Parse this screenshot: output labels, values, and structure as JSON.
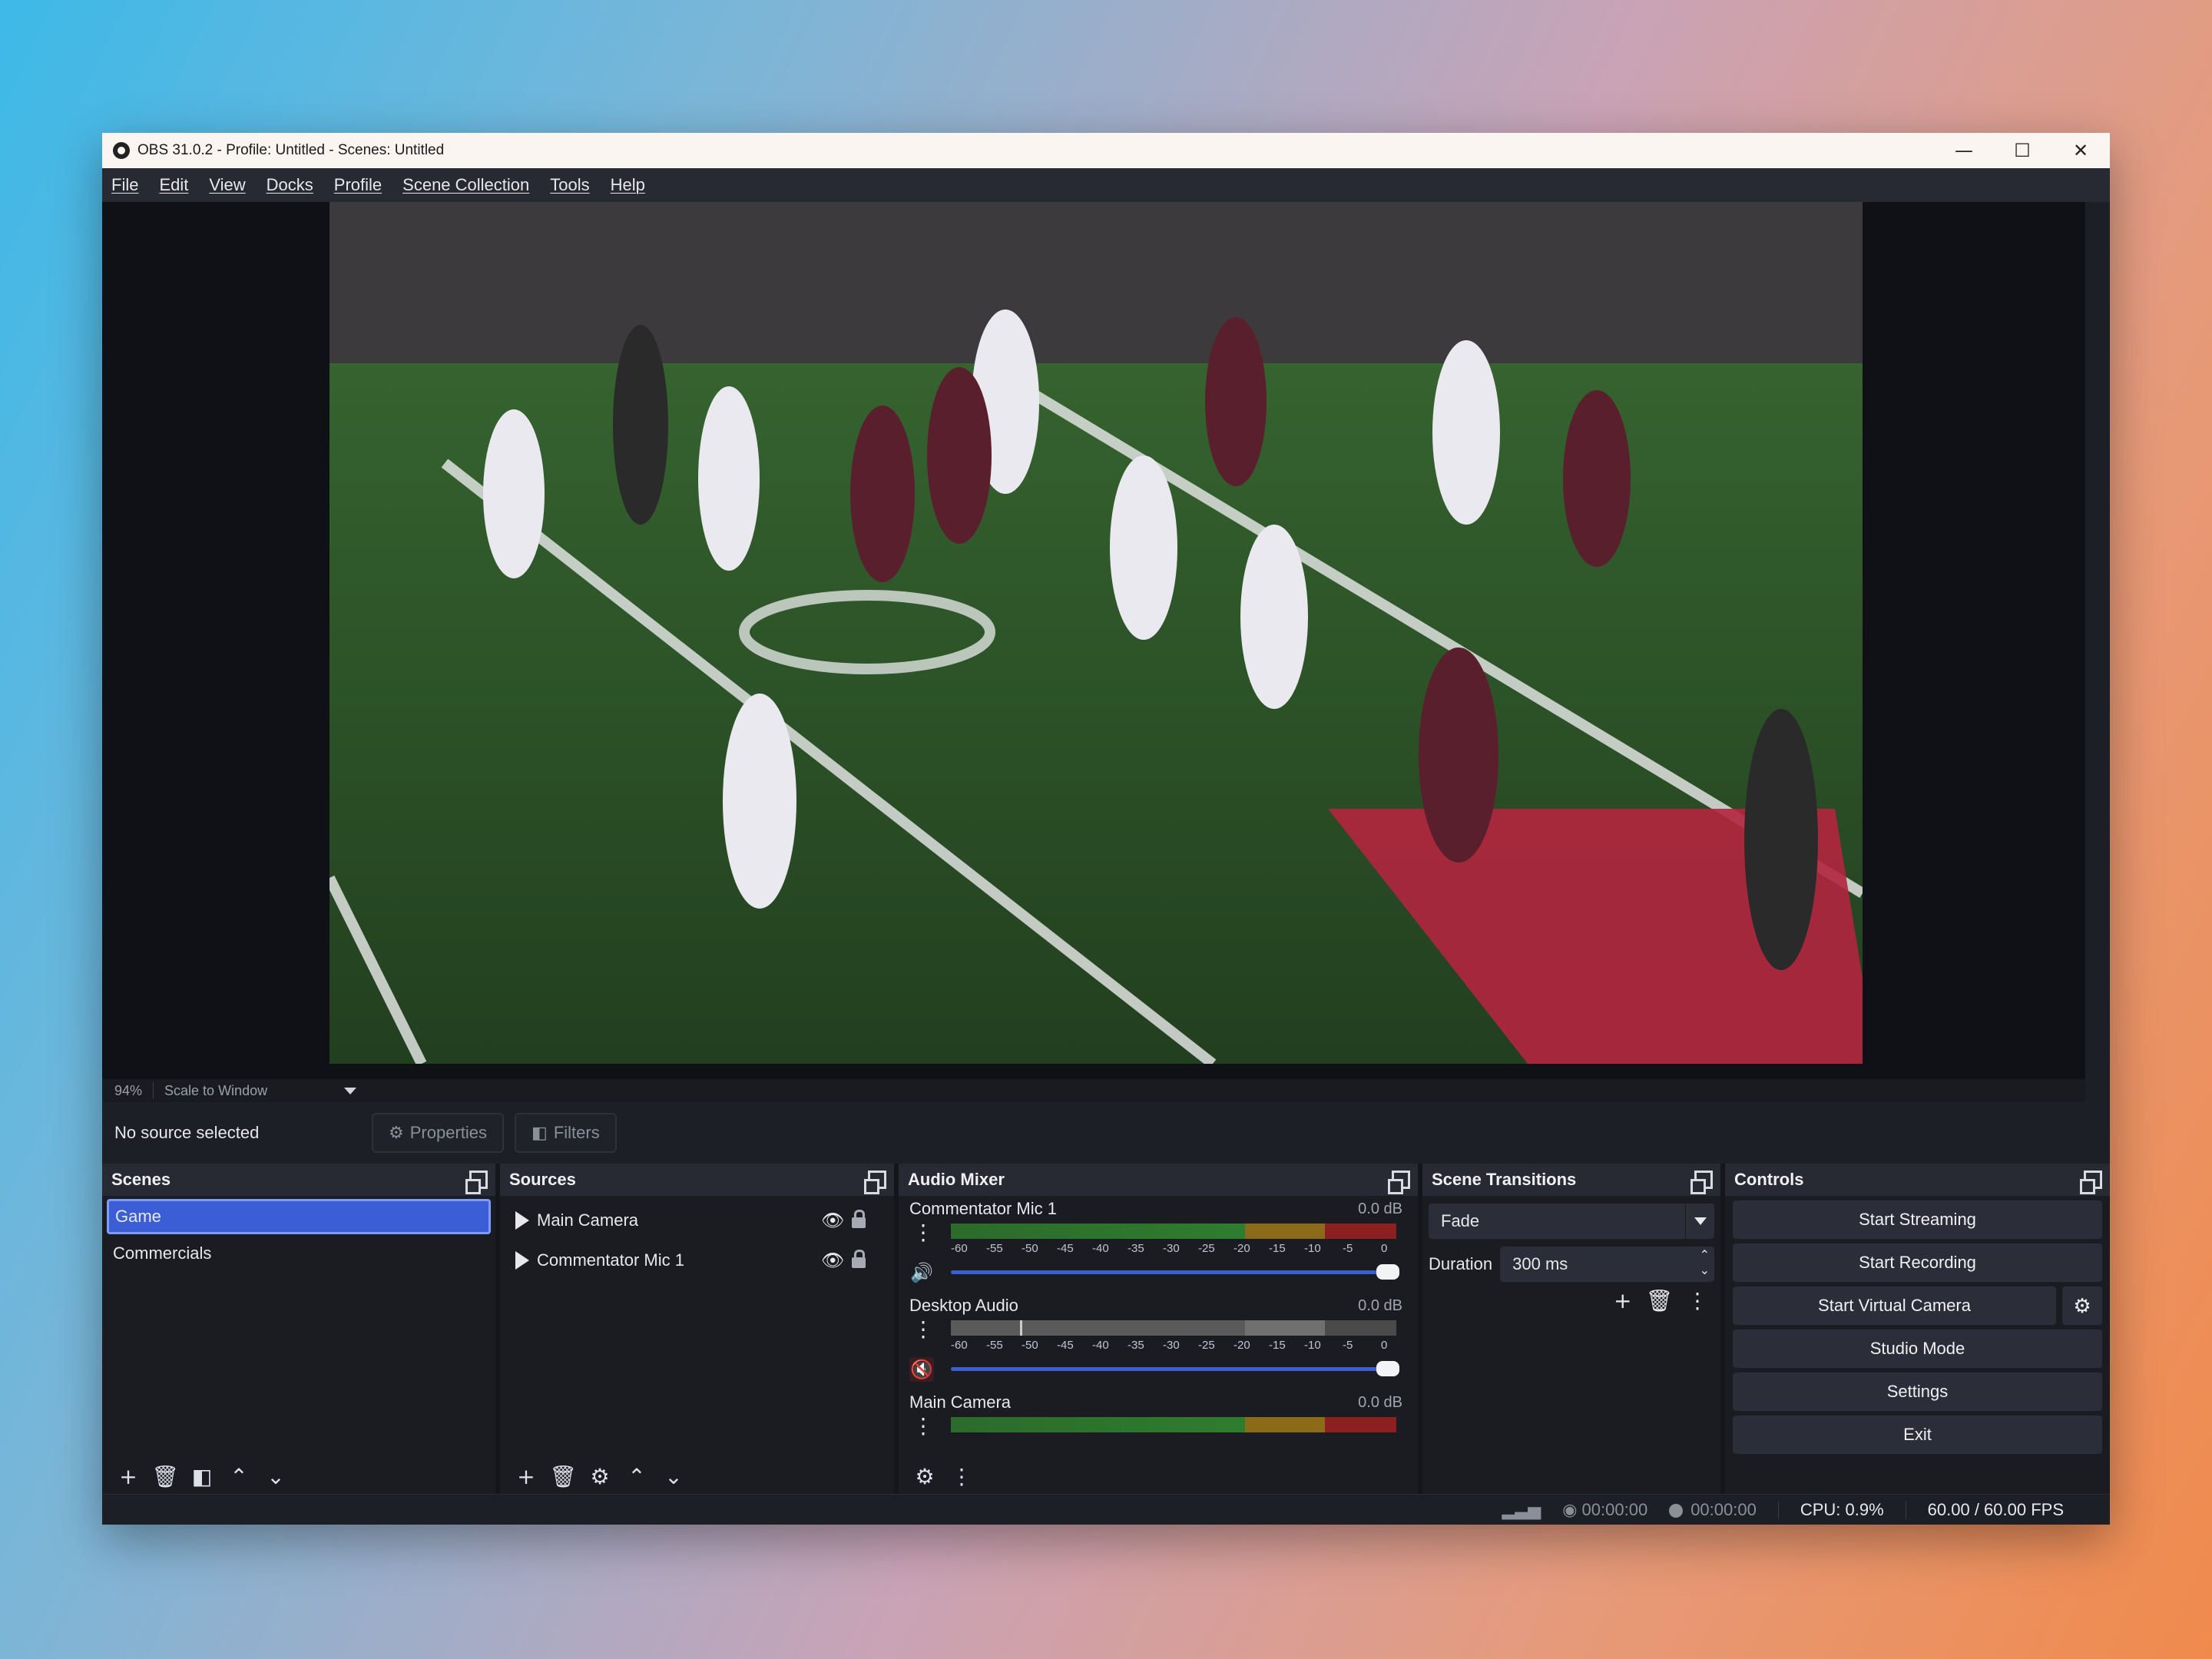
{
  "window": {
    "title": "OBS 31.0.2 - Profile: Untitled - Scenes: Untitled",
    "controls": [
      "—",
      "☐",
      "✕"
    ]
  },
  "menu": [
    "File",
    "Edit",
    "View",
    "Docks",
    "Profile",
    "Scene Collection",
    "Tools",
    "Help"
  ],
  "zoombar": {
    "zoom": "94%",
    "mode": "Scale to Window"
  },
  "sourcebar": {
    "status": "No source selected",
    "properties": "Properties",
    "filters": "Filters"
  },
  "scenes": {
    "title": "Scenes",
    "items": [
      "Game",
      "Commercials"
    ],
    "selected": "Game"
  },
  "sources": {
    "title": "Sources",
    "items": [
      "Main Camera",
      "Commentator Mic 1"
    ]
  },
  "mixer": {
    "title": "Audio Mixer",
    "scale": [
      "-60",
      "-55",
      "-50",
      "-45",
      "-40",
      "-35",
      "-30",
      "-25",
      "-20",
      "-15",
      "-10",
      "-5",
      "0"
    ],
    "channels": [
      {
        "name": "Commentator Mic 1",
        "db": "0.0 dB",
        "muted": false
      },
      {
        "name": "Desktop Audio",
        "db": "0.0 dB",
        "muted": true
      },
      {
        "name": "Main Camera",
        "db": "0.0 dB",
        "muted": false
      }
    ]
  },
  "transitions": {
    "title": "Scene Transitions",
    "selected": "Fade",
    "duration_label": "Duration",
    "duration_value": "300 ms"
  },
  "controls": {
    "title": "Controls",
    "start_streaming": "Start Streaming",
    "start_recording": "Start Recording",
    "start_virtual_camera": "Start Virtual Camera",
    "studio_mode": "Studio Mode",
    "settings": "Settings",
    "exit": "Exit"
  },
  "status": {
    "stream_time": "00:00:00",
    "rec_time": "00:00:00",
    "cpu": "CPU: 0.9%",
    "fps": "60.00 / 60.00 FPS"
  },
  "colors": {
    "accent": "#3b5ed6",
    "panel": "#1a1c22",
    "header": "#272a33"
  }
}
